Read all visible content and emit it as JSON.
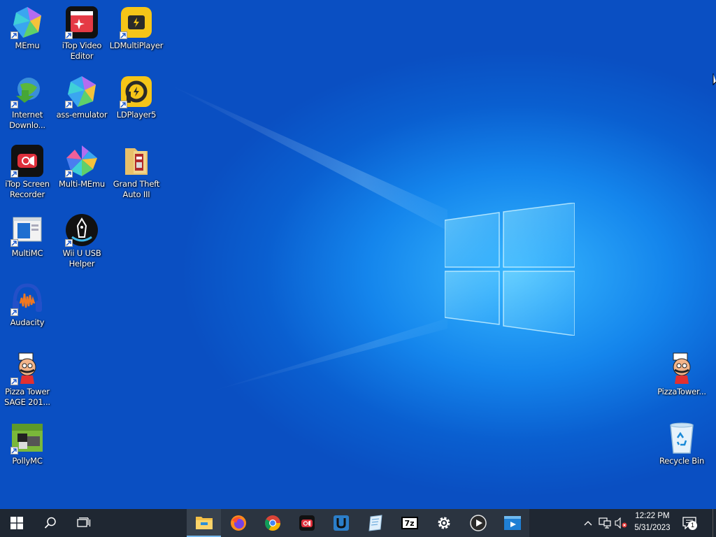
{
  "desktop": {
    "icons_left": [
      {
        "label": "MEmu",
        "icon": "memu-icon"
      },
      {
        "label": "iTop Video\nEditor",
        "icon": "itop-video-editor-icon"
      },
      {
        "label": "LDMultiPlayer",
        "icon": "ldmultiplayer-icon"
      },
      {
        "label": "Internet\nDownlo...",
        "icon": "internet-download-manager-icon"
      },
      {
        "label": "ass-emulator",
        "icon": "memu-icon"
      },
      {
        "label": "LDPlayer5",
        "icon": "ldplayer-icon"
      },
      {
        "label": "iTop Screen\nRecorder",
        "icon": "itop-screen-recorder-icon"
      },
      {
        "label": "Multi-MEmu",
        "icon": "multi-memu-icon"
      },
      {
        "label": "Grand Theft\nAuto III",
        "icon": "folder-icon"
      },
      {
        "label": "MultiMC",
        "icon": "multimc-icon"
      },
      {
        "label": "Wii U USB\nHelper",
        "icon": "wii-u-usb-helper-icon"
      },
      {
        "label": "Audacity",
        "icon": "audacity-icon"
      },
      {
        "label": "Pizza Tower\nSAGE 201...",
        "icon": "pizza-tower-icon"
      },
      {
        "label": "PollyMC",
        "icon": "pollymc-icon"
      }
    ],
    "icons_right": [
      {
        "label": "PizzaTower...",
        "icon": "pizza-tower-icon"
      },
      {
        "label": "Recycle Bin",
        "icon": "recycle-bin-icon"
      }
    ]
  },
  "taskbar": {
    "start": "windows-start-icon",
    "search": "search-icon",
    "task_view": "task-view-icon",
    "pinned": [
      {
        "name": "file-explorer-icon",
        "active": true
      },
      {
        "name": "firefox-icon",
        "active": false
      },
      {
        "name": "chrome-icon",
        "active": false
      },
      {
        "name": "itop-screen-recorder-icon",
        "active": false
      },
      {
        "name": "wii-u-usb-helper-icon",
        "active": false
      },
      {
        "name": "notepad-icon",
        "active": false
      },
      {
        "name": "7zip-icon",
        "active": false
      },
      {
        "name": "settings-gear-icon",
        "active": false
      },
      {
        "name": "media-player-icon",
        "active": false
      },
      {
        "name": "video-editor-icon",
        "active": false
      }
    ],
    "sevenzip_label": "7z",
    "tray": {
      "chevron": "chevron-up-icon",
      "network": "network-icon",
      "volume": "volume-muted-icon",
      "time": "12:22 PM",
      "date": "5/31/2023",
      "notifications_count": "1"
    }
  },
  "colors": {
    "taskbar_bg": "#1f2732",
    "desktop_blue": "#1485ec",
    "accent": "#76b9ed"
  }
}
